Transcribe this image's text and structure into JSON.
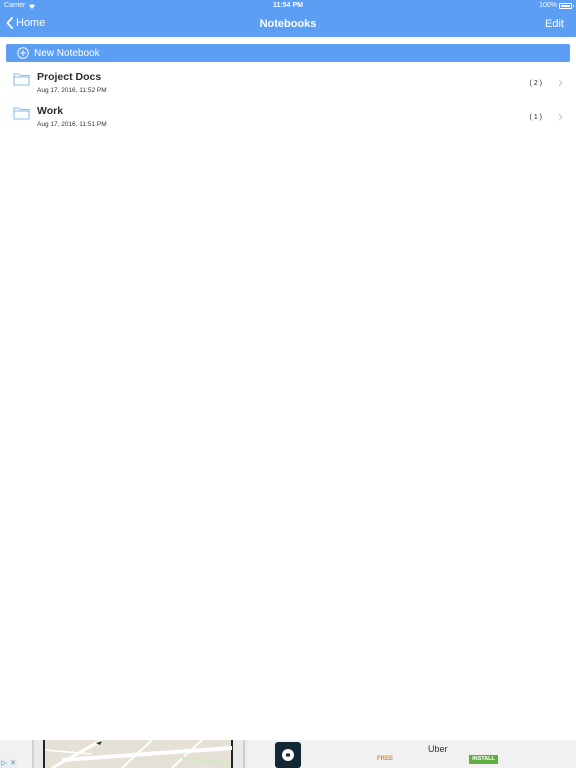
{
  "status_bar": {
    "carrier": "Carrier",
    "time": "11:54 PM",
    "battery": "100%"
  },
  "nav": {
    "back_label": "Home",
    "title": "Notebooks",
    "edit_label": "Edit"
  },
  "new_notebook": {
    "label": "New Notebook"
  },
  "notebooks": [
    {
      "name": "Project Docs",
      "date": "Aug 17, 2016, 11:52 PM",
      "count": "( 2 )"
    },
    {
      "name": "Work",
      "date": "Aug 17, 2016, 11:51 PM",
      "count": "( 1 )"
    }
  ],
  "ad": {
    "title": "Uber",
    "price": "FREE",
    "install_label": "INSTALL"
  },
  "colors": {
    "accent": "#5b9ef4",
    "background": "#ffffff"
  }
}
